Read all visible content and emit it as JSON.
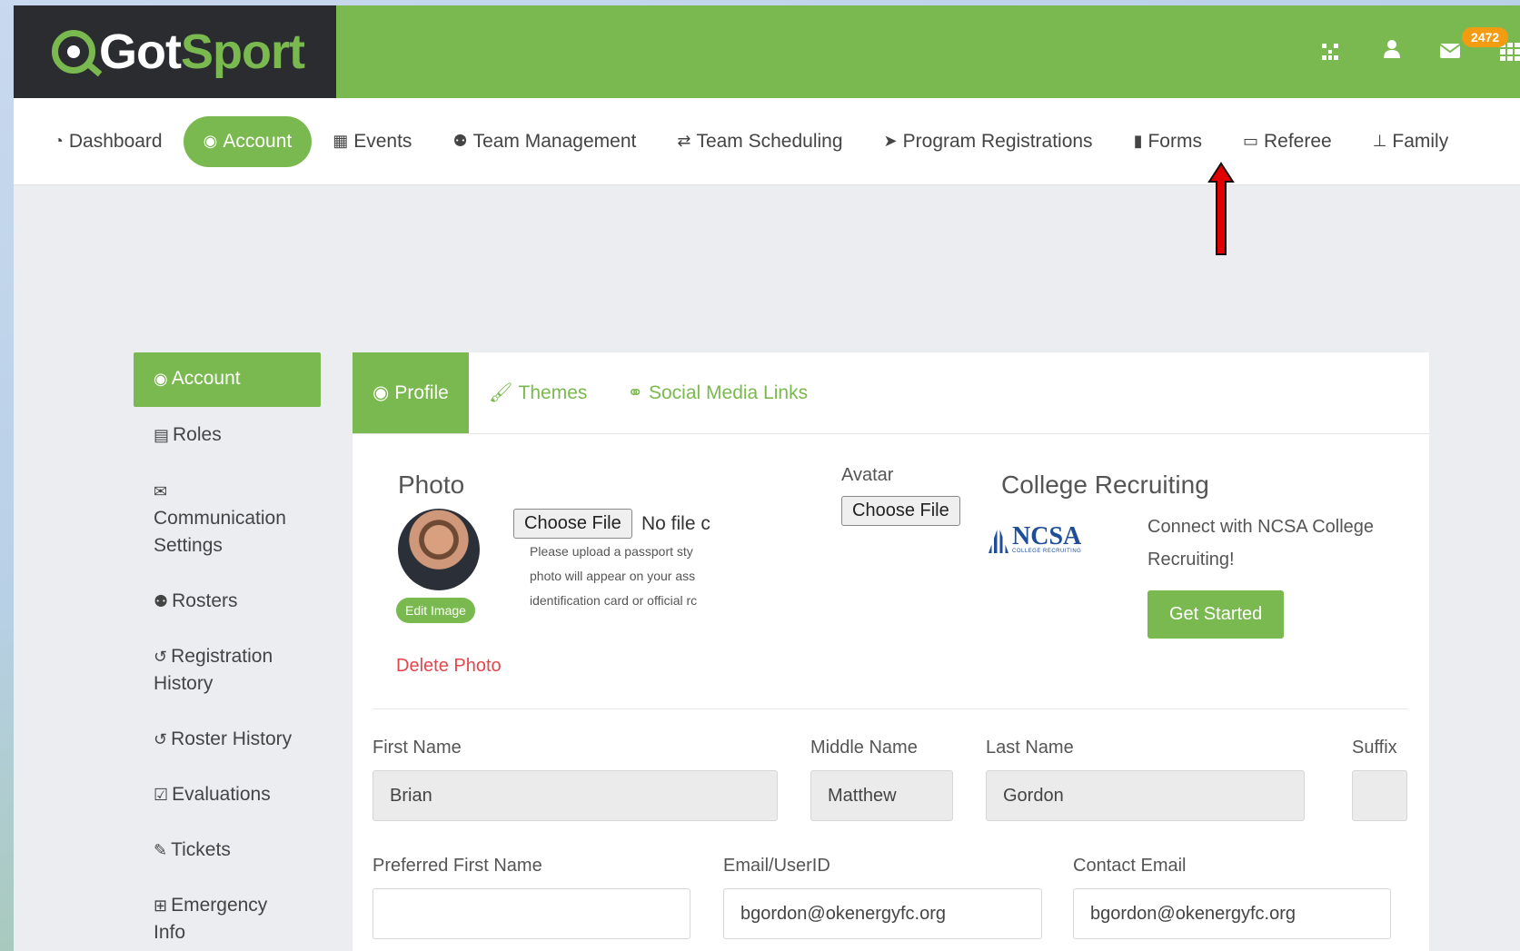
{
  "header": {
    "logo_got": "Got",
    "logo_sport": "Sport",
    "mail_badge": "2472",
    "icons": [
      "qr-code-icon",
      "user-icon",
      "envelope-icon",
      "apps-grid-icon"
    ]
  },
  "nav": {
    "items": [
      {
        "label": "Dashboard",
        "icon": "tachometer-icon"
      },
      {
        "label": "Account",
        "icon": "user-circle-icon",
        "active": true
      },
      {
        "label": "Events",
        "icon": "calendar-icon"
      },
      {
        "label": "Team Management",
        "icon": "users-icon"
      },
      {
        "label": "Team Scheduling",
        "icon": "exchange-icon"
      },
      {
        "label": "Program Registrations",
        "icon": "paper-plane-icon"
      },
      {
        "label": "Forms",
        "icon": "file-icon"
      },
      {
        "label": "Referee",
        "icon": "calendar-empty-icon"
      },
      {
        "label": "Family",
        "icon": "sitemap-icon"
      }
    ]
  },
  "sidebar": {
    "items": [
      {
        "label": "Account",
        "active": true
      },
      {
        "label": "Roles"
      },
      {
        "label": "Communication Settings"
      },
      {
        "label": "Rosters"
      },
      {
        "label": "Registration History"
      },
      {
        "label": "Roster History"
      },
      {
        "label": "Evaluations"
      },
      {
        "label": "Tickets"
      },
      {
        "label": "Emergency Info"
      }
    ]
  },
  "tabs": [
    {
      "label": "Profile",
      "active": true
    },
    {
      "label": "Themes"
    },
    {
      "label": "Social Media Links"
    }
  ],
  "photo": {
    "title": "Photo",
    "choose_file": "Choose File",
    "no_file": "No file c",
    "hint_lines": [
      "Please upload a passport sty",
      "photo will appear on your ass",
      "identification card or official rc"
    ],
    "edit_image": "Edit Image",
    "delete_photo": "Delete Photo"
  },
  "avatar_section": {
    "title": "Avatar",
    "choose_file": "Choose File"
  },
  "college": {
    "title": "College Recruiting",
    "logo_text": "NCSA",
    "logo_sub": "COLLEGE RECRUITING",
    "description": "Connect with NCSA College Recruiting!",
    "button": "Get Started"
  },
  "form": {
    "first_name": {
      "label": "First Name",
      "value": "Brian"
    },
    "middle_name": {
      "label": "Middle Name",
      "value": "Matthew"
    },
    "last_name": {
      "label": "Last Name",
      "value": "Gordon"
    },
    "suffix": {
      "label": "Suffix",
      "value": ""
    },
    "preferred_first_name": {
      "label": "Preferred First Name",
      "value": ""
    },
    "email_userid": {
      "label": "Email/UserID",
      "value": "bgordon@okenergyfc.org"
    },
    "contact_email": {
      "label": "Contact Email",
      "value": "bgordon@okenergyfc.org"
    }
  },
  "colors": {
    "brand_green": "#7ab94f",
    "logo_bg": "#2b2c2f",
    "badge_orange": "#f39c12",
    "delete_red": "#e2474c",
    "annotation_arrow": "#e00000"
  }
}
